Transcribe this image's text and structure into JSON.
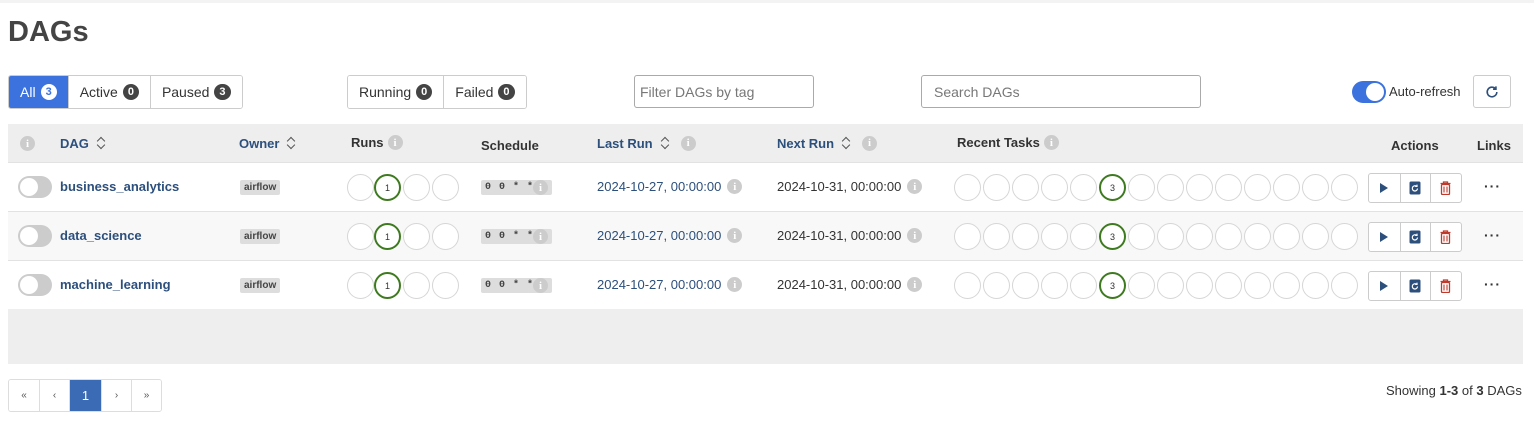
{
  "page": {
    "title": "DAGs"
  },
  "status_filter": [
    {
      "label": "All",
      "count": "3",
      "active": true
    },
    {
      "label": "Active",
      "count": "0"
    },
    {
      "label": "Paused",
      "count": "3"
    }
  ],
  "state_filter": [
    {
      "label": "Running",
      "count": "0"
    },
    {
      "label": "Failed",
      "count": "0"
    }
  ],
  "tag_filter": {
    "placeholder": "Filter DAGs by tag"
  },
  "search": {
    "placeholder": "Search DAGs"
  },
  "auto_refresh": {
    "label": "Auto-refresh",
    "on": true
  },
  "table": {
    "headers": {
      "dag": "DAG",
      "owner": "Owner",
      "runs": "Runs",
      "schedule": "Schedule",
      "last_run": "Last Run",
      "next_run": "Next Run",
      "recent_tasks": "Recent Tasks",
      "actions": "Actions",
      "links": "Links"
    },
    "rows": [
      {
        "name": "business_analytics",
        "owner": "airflow",
        "run_success": "1",
        "schedule": "0 0 * * *",
        "last_run": "2024-10-27, 00:00:00",
        "next_run": "2024-10-31, 00:00:00",
        "task_success": "3",
        "links": "···"
      },
      {
        "name": "data_science",
        "owner": "airflow",
        "run_success": "1",
        "schedule": "0 0 * * *",
        "last_run": "2024-10-27, 00:00:00",
        "next_run": "2024-10-31, 00:00:00",
        "task_success": "3",
        "links": "···"
      },
      {
        "name": "machine_learning",
        "owner": "airflow",
        "run_success": "1",
        "schedule": "0 0 * * *",
        "last_run": "2024-10-27, 00:00:00",
        "next_run": "2024-10-31, 00:00:00",
        "task_success": "3",
        "links": "···"
      }
    ]
  },
  "pagination": {
    "first": "«",
    "prev": "‹",
    "current": "1",
    "next": "›",
    "last": "»"
  },
  "footer": {
    "showing_prefix": "Showing ",
    "range": "1-3",
    "of": " of ",
    "total": "3",
    "suffix": " DAGs"
  },
  "colors": {
    "accent": "#3b72de",
    "success": "#3e7a1f",
    "danger": "#c0392b",
    "link": "#2c4f7c"
  },
  "icons": {
    "info": "info-icon",
    "sort": "sort-icon",
    "refresh": "refresh-icon",
    "trigger": "play-icon",
    "clear": "refresh-doc-icon",
    "delete": "trash-icon"
  }
}
